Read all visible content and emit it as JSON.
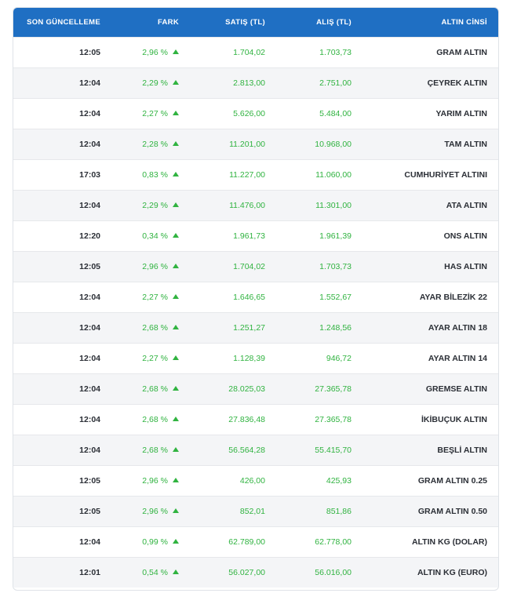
{
  "table": {
    "headers": {
      "name": "ALTIN CİNSİ",
      "buy": "ALIŞ (TL)",
      "sell": "SATIŞ (TL)",
      "diff": "FARK",
      "updated": "SON GÜNCELLEME"
    },
    "rows": [
      {
        "name": "GRAM ALTIN",
        "buy": "1.703,73",
        "sell": "1.704,02",
        "diff": "% 2,96",
        "time": "12:05"
      },
      {
        "name": "ÇEYREK ALTIN",
        "buy": "2.751,00",
        "sell": "2.813,00",
        "diff": "% 2,29",
        "time": "12:04"
      },
      {
        "name": "YARIM ALTIN",
        "buy": "5.484,00",
        "sell": "5.626,00",
        "diff": "% 2,27",
        "time": "12:04"
      },
      {
        "name": "TAM ALTIN",
        "buy": "10.968,00",
        "sell": "11.201,00",
        "diff": "% 2,28",
        "time": "12:04"
      },
      {
        "name": "CUMHURİYET ALTINI",
        "buy": "11.060,00",
        "sell": "11.227,00",
        "diff": "% 0,83",
        "time": "17:03"
      },
      {
        "name": "ATA ALTIN",
        "buy": "11.301,00",
        "sell": "11.476,00",
        "diff": "% 2,29",
        "time": "12:04"
      },
      {
        "name": "ONS ALTIN",
        "buy": "1.961,39",
        "sell": "1.961,73",
        "diff": "% 0,34",
        "time": "12:20"
      },
      {
        "name": "HAS ALTIN",
        "buy": "1.703,73",
        "sell": "1.704,02",
        "diff": "% 2,96",
        "time": "12:05"
      },
      {
        "name": "22 AYAR BİLEZİK",
        "buy": "1.552,67",
        "sell": "1.646,65",
        "diff": "% 2,27",
        "time": "12:04"
      },
      {
        "name": "18 AYAR ALTIN",
        "buy": "1.248,56",
        "sell": "1.251,27",
        "diff": "% 2,68",
        "time": "12:04"
      },
      {
        "name": "14 AYAR ALTIN",
        "buy": "946,72",
        "sell": "1.128,39",
        "diff": "% 2,27",
        "time": "12:04"
      },
      {
        "name": "GREMSE ALTIN",
        "buy": "27.365,78",
        "sell": "28.025,03",
        "diff": "% 2,68",
        "time": "12:04"
      },
      {
        "name": "İKİBUÇUK ALTIN",
        "buy": "27.365,78",
        "sell": "27.836,48",
        "diff": "% 2,68",
        "time": "12:04"
      },
      {
        "name": "BEŞLİ ALTIN",
        "buy": "55.415,70",
        "sell": "56.564,28",
        "diff": "% 2,68",
        "time": "12:04"
      },
      {
        "name": "0.25 GRAM ALTIN",
        "buy": "425,93",
        "sell": "426,00",
        "diff": "% 2,96",
        "time": "12:05"
      },
      {
        "name": "0.50 GRAM ALTIN",
        "buy": "851,86",
        "sell": "852,01",
        "diff": "% 2,96",
        "time": "12:05"
      },
      {
        "name": "ALTIN KG (DOLAR)",
        "buy": "62.778,00",
        "sell": "62.789,00",
        "diff": "% 0,99",
        "time": "12:04"
      },
      {
        "name": "ALTIN KG (EURO)",
        "buy": "56.016,00",
        "sell": "56.027,00",
        "diff": "% 0,54",
        "time": "12:01"
      }
    ]
  },
  "colors": {
    "header": "#1f6fc3",
    "positive": "#30b340"
  },
  "icons": {
    "change": "triangle-up-icon"
  }
}
